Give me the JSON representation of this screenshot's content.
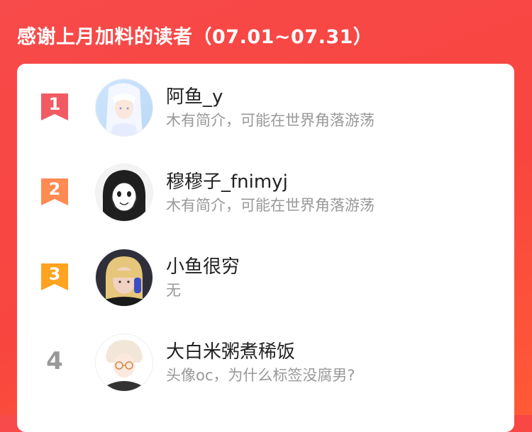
{
  "header": {
    "title": "感谢上月加料的读者（07.01~07.31）"
  },
  "colors": {
    "background": "#f74a4a",
    "rank1": "#f25a63",
    "rank2": "#ff8a52",
    "rank3": "#ffa321",
    "muted": "#999999"
  },
  "readers": [
    {
      "rank": "1",
      "name": "阿鱼_y",
      "desc": "木有简介，可能在世界角落游荡",
      "badge": "bookmark-ribbon-icon",
      "avatar": "anime-white-hair-avatar"
    },
    {
      "rank": "2",
      "name": "穆穆子_fnimyj",
      "desc": "木有简介，可能在世界角落游荡",
      "badge": "bookmark-ribbon-icon",
      "avatar": "manga-girl-avatar"
    },
    {
      "rank": "3",
      "name": "小鱼很穷",
      "desc": "无",
      "badge": "bookmark-ribbon-icon",
      "avatar": "photo-blonde-avatar"
    },
    {
      "rank": "4",
      "name": "大白米粥煮稀饭",
      "desc": "头像oc，为什么标签没腐男?",
      "badge": "",
      "avatar": "anime-glasses-avatar"
    }
  ]
}
